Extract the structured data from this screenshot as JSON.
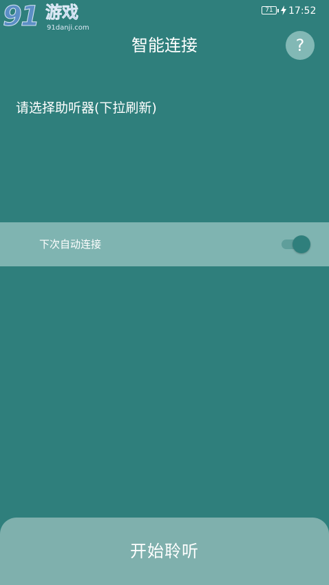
{
  "watermark": {
    "number": "91",
    "name": "游戏",
    "site": "91danji.com"
  },
  "status_bar": {
    "battery_level": "71",
    "time": "17:52"
  },
  "header": {
    "title": "智能连接",
    "help_label": "?"
  },
  "device_list": {
    "prompt": "请选择助听器(下拉刷新)"
  },
  "auto_connect": {
    "label": "下次自动连接",
    "enabled": true
  },
  "footer": {
    "start_label": "开始聆听"
  },
  "colors": {
    "background": "#2f7f7c",
    "panel": "#7fb4b1",
    "text": "#ffffff"
  }
}
